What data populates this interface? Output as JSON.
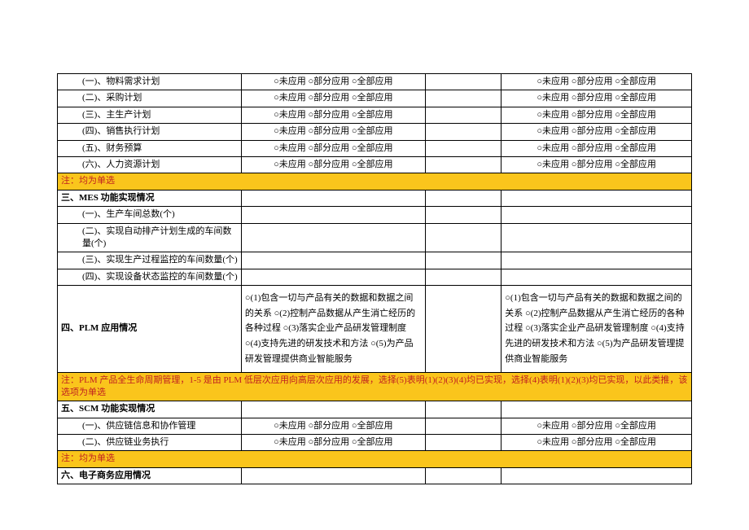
{
  "opts3": "○未应用 ○部分应用 ○全部应用",
  "rows_top": [
    "(一)、物料需求计划",
    "(二)、采购计划",
    "(三)、主生产计划",
    "(四)、销售执行计划",
    "(五)、财务预算",
    "(六)、人力资源计划"
  ],
  "note1": "注：均为单选",
  "section3": "三、MES 功能实现情况",
  "mes_rows": [
    "(一)、生产车间总数(个)",
    "(二)、实现自动排产计划生成的车间数量(个)",
    "(三)、实现生产过程监控的车间数量(个)",
    "(四)、实现设备状态监控的车间数量(个)"
  ],
  "section4": "四、PLM 应用情况",
  "plm_left": "○(1)包含一切与产品有关的数据和数据之间的关系 ○(2)控制产品数据从产生消亡经历的各种过程 ○(3)落实企业产品研发管理制度 ○(4)支持先进的研发技术和方法 ○(5)为产品研发管理提供商业智能服务",
  "plm_right": "○(1)包含一切与产品有关的数据和数据之间的关系 ○(2)控制产品数据从产生消亡经历的各种过程 ○(3)落实企业产品研发管理制度 ○(4)支持先进的研发技术和方法 ○(5)为产品研发管理提供商业智能服务",
  "note2": "注：PLM 产品全生命周期管理，1-5 是由 PLM 低层次应用向高层次应用的发展，选择(5)表明(1)(2)(3)(4)均已实现，选择(4)表明(1)(2)(3)均已实现，以此类推，该选项为单选",
  "section5": "五、SCM 功能实现情况",
  "scm_rows": [
    "(一)、供应链信息和协作管理",
    "(二)、供应链业务执行"
  ],
  "note3": "注：均为单选",
  "section6": "六、电子商务应用情况"
}
